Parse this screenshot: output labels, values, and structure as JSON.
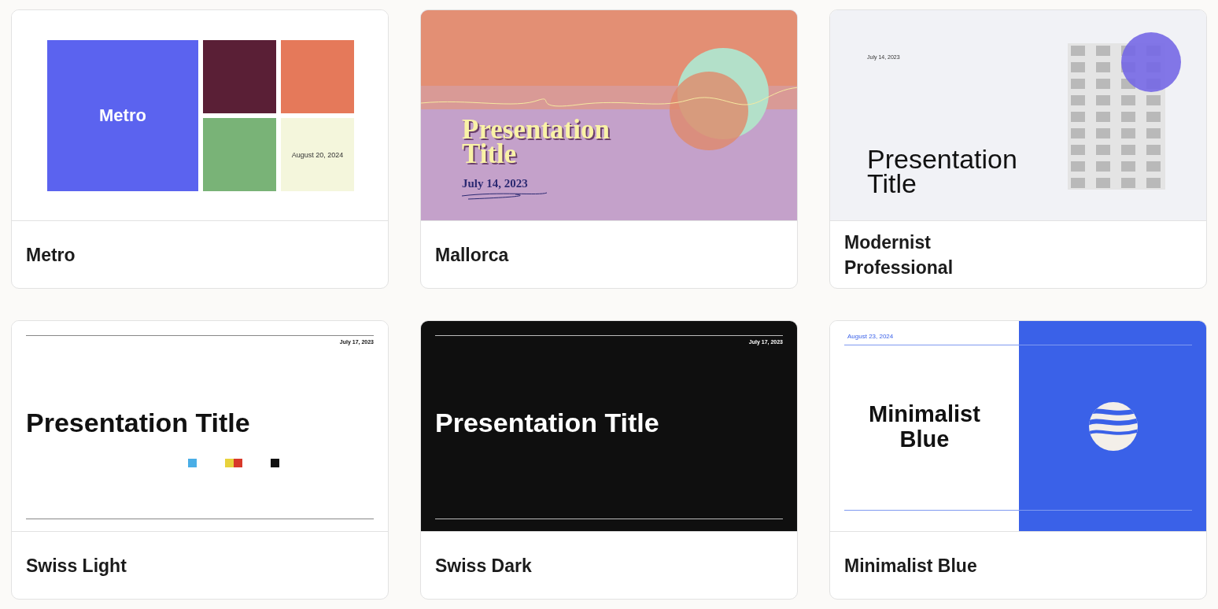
{
  "templates": [
    {
      "name": "Metro",
      "kind": "metro",
      "title": "Metro",
      "date": "August 20, 2024"
    },
    {
      "name": "Mallorca",
      "kind": "mallorca",
      "title": "Presentation Title",
      "date": "July 14, 2023"
    },
    {
      "name": "Modernist Professional",
      "kind": "modernist",
      "title": "Presentation Title",
      "date": "July 14, 2023"
    },
    {
      "name": "Swiss Light",
      "kind": "swiss-light",
      "title": "Presentation Title",
      "date": "July 17, 2023"
    },
    {
      "name": "Swiss Dark",
      "kind": "swiss-dark",
      "title": "Presentation Title",
      "date": "July 17, 2023"
    },
    {
      "name": "Minimalist Blue",
      "kind": "minimalist-blue",
      "title": "Minimalist Blue",
      "date": "August 23, 2024"
    }
  ]
}
